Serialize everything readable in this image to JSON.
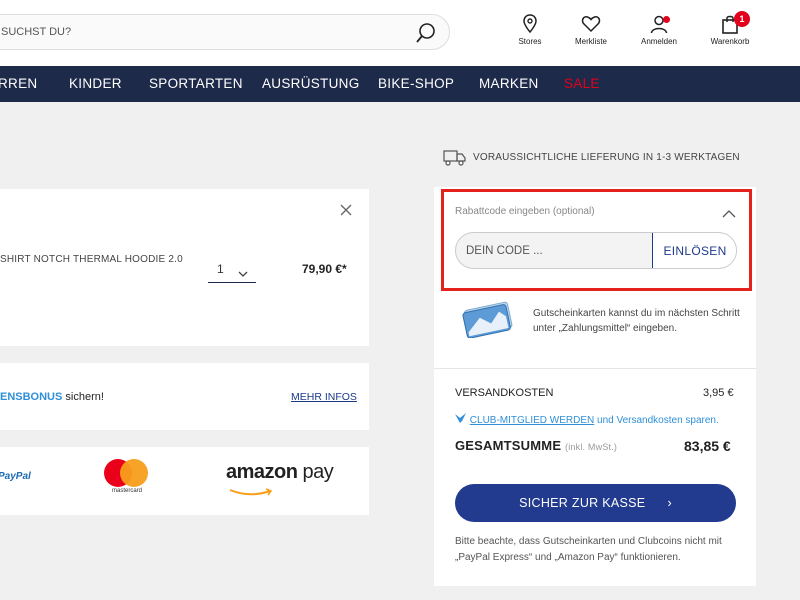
{
  "header": {
    "search_placeholder": "SUCHST DU?",
    "icons": {
      "stores": "Stores",
      "wishlist": "Merkliste",
      "login": "Anmelden",
      "cart": "Warenkorb",
      "cart_count": "1"
    }
  },
  "nav": [
    "RREN",
    "KINDER",
    "SPORTARTEN",
    "AUSRÜSTUNG",
    "BIKE-SHOP",
    "MARKEN",
    "SALE"
  ],
  "product": {
    "name": "SHIRT NOTCH THERMAL HOODIE 2.0",
    "quantity": "1",
    "price": "79,90 €*"
  },
  "bonus": {
    "highlight": "ENSBONUS",
    "text": " sichern!",
    "link": "MEHR INFOS"
  },
  "payment": {
    "paypal": "PayPal",
    "mastercard": "mastercard",
    "amazon_word": "amazon",
    "amazon_pay": " pay"
  },
  "delivery": "VORAUSSICHTLICHE LIEFERUNG IN 1-3 WERKTAGEN",
  "coupon": {
    "title": "Rabattcode eingeben (optional)",
    "placeholder": "DEIN CODE ...",
    "button": "EINLÖSEN",
    "giftcard_text": "Gutscheinkarten kannst du im nächsten Schritt unter „Zahlungsmittel“ eingeben."
  },
  "summary": {
    "shipping_label": "VERSANDKOSTEN",
    "shipping_value": "3,95 €",
    "club_link": "CLUB-MITGLIED WERDEN",
    "club_text": " und Versandkosten sparen.",
    "total_label": "GESAMTSUMME",
    "total_note": "(inkl. MwSt.)",
    "total_value": "83,85 €",
    "checkout": "SICHER ZUR KASSE",
    "note": "Bitte beachte, dass Gutscheinkarten und Clubcoins nicht mit „PayPal Express“ und „Amazon Pay“ funktionieren."
  },
  "colors": {
    "nav_bg": "#1d2a4a",
    "sale": "#e3001b",
    "highlight_border": "#e3221b",
    "checkout_bg": "#223b8f",
    "link_blue": "#2f8fd8"
  }
}
